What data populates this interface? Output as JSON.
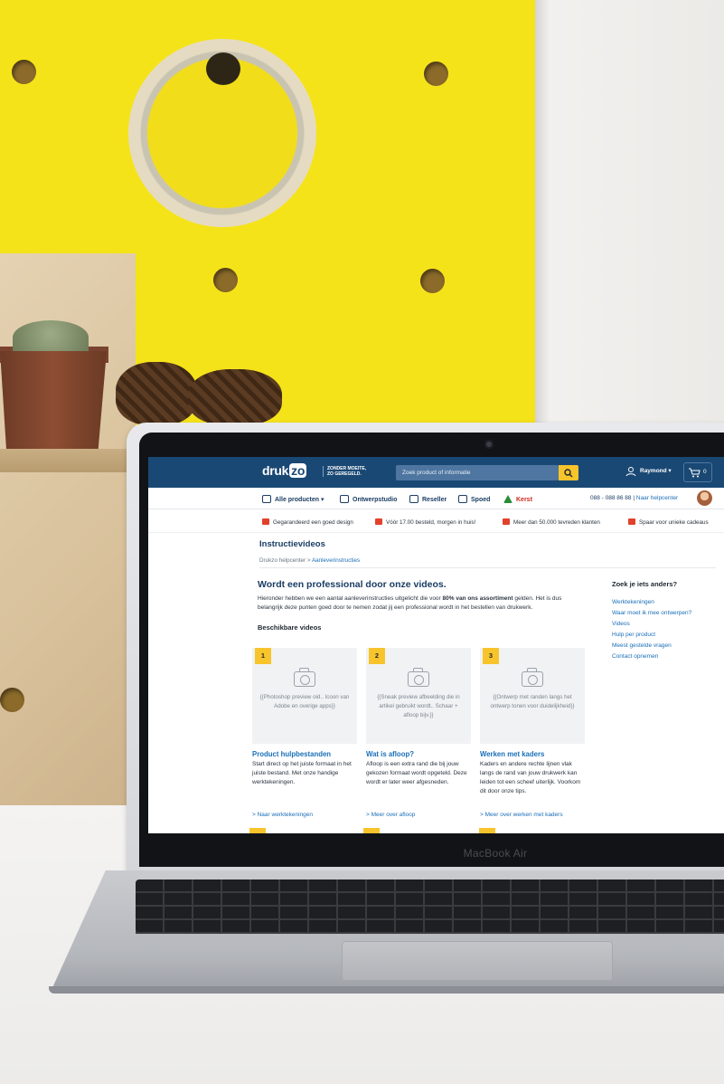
{
  "laptop": {
    "brand": "MacBook Air"
  },
  "site": {
    "logo_main": "druk",
    "logo_accent": "zo",
    "tagline_line1": "ZONDER MOEITE,",
    "tagline_line2": "ZO GEREGELD.",
    "search_placeholder": "Zoek product of informatie",
    "user_name": "Raymond",
    "cart_count": "0"
  },
  "nav": {
    "items": [
      {
        "label": "Alle producten"
      },
      {
        "label": "Ontwerpstudio"
      },
      {
        "label": "Reseller"
      },
      {
        "label": "Spoed"
      },
      {
        "label": "Kerst"
      }
    ],
    "phone": "088 - 088 86 88",
    "separator": "|",
    "helpcenter": "Naar helpcenter"
  },
  "usps": [
    "Gegarandeerd een goed design",
    "Vóór 17.00 besteld, morgen in huis!",
    "Meer dan 50.000 tevreden klanten",
    "Spaar voor unieke cadeaus"
  ],
  "page": {
    "title": "Instructievideos",
    "breadcrumb_home": "Drukzo helpcenter",
    "breadcrumb_sep": ">",
    "breadcrumb_current": "Aanleverinstructies",
    "intro_heading": "Wordt een professional door onze videos.",
    "intro_part1": "Hieronder hebben we een aantal aanleverinstructies uitgelicht die voor ",
    "intro_bold": "80% van ons assortiment",
    "intro_part2": " gelden. Het is dus belangrijk deze punten goed door te nemen zodat jij een professional wordt in het bestellen van drukwerk.",
    "videos_heading": "Beschikbare videos"
  },
  "cards": [
    {
      "num": "1",
      "placeholder": "{{Photoshop preview oid.. Icoon van Adobe en overige apps}}",
      "title": "Product hulpbestanden",
      "text": "Start direct op het juiste formaat in het juiste bestand. Met onze handige werktekeningen.",
      "link": "> Naar werktekeningen"
    },
    {
      "num": "2",
      "placeholder": "{{Sneak preview afbeelding die in artikel gebruikt wordt.. Schaar + afloop bijv.}}",
      "title": "Wat is afloop?",
      "text": "Afloop is een extra rand die bij jouw gekozen formaat wordt opgeteld. Deze wordt er later weer afgesneden.",
      "link": "> Meer over afloop"
    },
    {
      "num": "3",
      "placeholder": "{{Ontwerp met randen langs het ontwerp tonen voor duidelijkheid}}",
      "title": "Werken met kaders",
      "text": "Kaders en andere rechte lijnen vlak langs de rand van jouw drukwerk kan leiden tot een scheef uiterlijk. Voorkom dit door onze tips.",
      "link": "> Meer over werken met kaders"
    }
  ],
  "aside": {
    "heading": "Zoek je iets anders?",
    "links": [
      "Werktekeningen",
      "Waar moet ik mee ontwerpen?",
      "Videos",
      "Hulp per product",
      "Meest gestelde vragen",
      "Contact opnemen"
    ]
  },
  "colors": {
    "brand_blue": "#1a4874",
    "accent_yellow": "#f7c42b",
    "link_blue": "#1a6fb8"
  }
}
